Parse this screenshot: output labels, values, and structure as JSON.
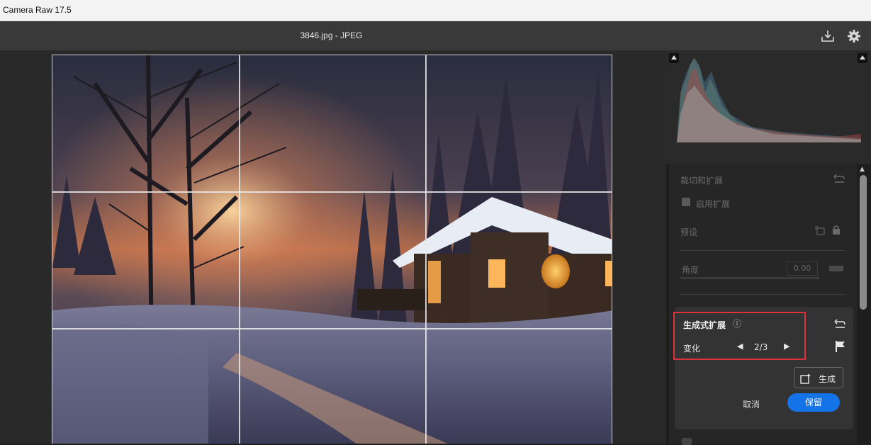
{
  "app": {
    "title": "Camera Raw 17.5"
  },
  "topbar": {
    "file_name": "3846.jpg -  JPEG",
    "save_icon": "save-download-icon",
    "settings_icon": "gear-icon"
  },
  "panel": {
    "section_title": "裁切和扩展",
    "enable_expand_label": "启用扩展",
    "enable_expand_checked": true,
    "preset_label": "预设",
    "angle_label": "角度",
    "angle_value": "0.00",
    "generative_expand": {
      "title": "生成式扩展",
      "variation_label": "变化",
      "variation_current": 2,
      "variation_total": 3,
      "variation_text": "2/3",
      "generate_label": "生成",
      "cancel_label": "取消",
      "keep_label": "保留"
    },
    "bottom_label": " "
  },
  "colors": {
    "accent": "#1473e6",
    "highlight_box": "#e0323c",
    "panel_bg": "#262626"
  }
}
